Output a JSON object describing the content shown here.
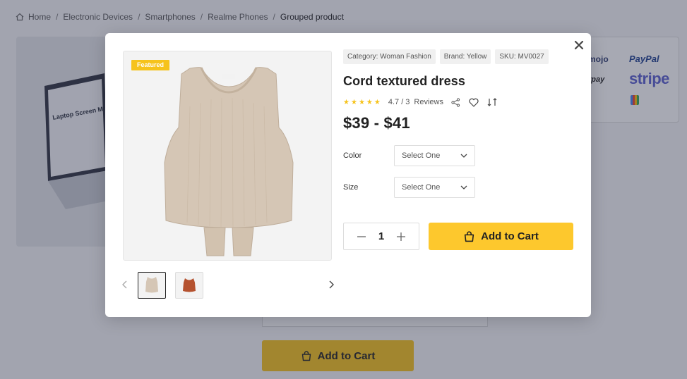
{
  "breadcrumb": {
    "items": [
      "Home",
      "Electronic Devices",
      "Smartphones",
      "Realme Phones",
      "Grouped product"
    ],
    "separator": "/"
  },
  "background": {
    "laptop_text": "Laptop Screen Mockup Template",
    "payments": [
      "mojo",
      "PayPal",
      "rpay",
      "stripe"
    ],
    "add_to_cart_label": "Add to Cart"
  },
  "modal": {
    "featured_label": "Featured",
    "tags": [
      "Category: Woman Fashion",
      "Brand: Yellow",
      "SKU: MV0027"
    ],
    "title": "Cord textured dress",
    "rating": {
      "stars": 5,
      "text": "4.7 / 3",
      "reviews_label": "Reviews"
    },
    "price": "$39 - $41",
    "color": {
      "label": "Color",
      "value": "Select One"
    },
    "size": {
      "label": "Size",
      "value": "Select One"
    },
    "quantity": "1",
    "add_to_cart_label": "Add to Cart"
  },
  "colors": {
    "accent": "#fdc82d",
    "overlay": "rgba(45,50,75,0.42)"
  },
  "icons": [
    "home-icon",
    "close-icon",
    "share-icon",
    "heart-icon",
    "compare-icon",
    "chevron-down-icon",
    "minus-icon",
    "plus-icon",
    "bag-icon",
    "chevron-left-icon",
    "chevron-right-icon"
  ]
}
